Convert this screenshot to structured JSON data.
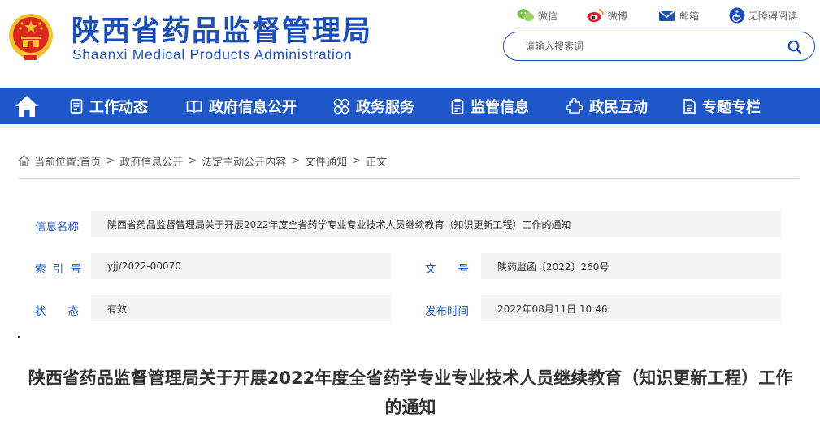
{
  "header": {
    "site_name_cn": "陕西省药品监督管理局",
    "site_name_en": "Shaanxi Medical Products Administration",
    "links": {
      "wechat": "微信",
      "weibo": "微博",
      "mailbox": "邮箱",
      "accessibility": "无障碍阅读"
    },
    "search": {
      "placeholder": "请输入搜索词"
    }
  },
  "nav": {
    "items": [
      {
        "label": "工作动态",
        "icon": "document-list-icon"
      },
      {
        "label": "政府信息公开",
        "icon": "book-icon"
      },
      {
        "label": "政务服务",
        "icon": "grid-icon"
      },
      {
        "label": "监管信息",
        "icon": "clipboard-icon"
      },
      {
        "label": "政民互动",
        "icon": "puzzle-icon"
      },
      {
        "label": "专题专栏",
        "icon": "file-icon"
      }
    ]
  },
  "breadcrumb": {
    "prefix": "当前位置:",
    "items": [
      "首页",
      "政府信息公开",
      "法定主动公开内容",
      "文件通知",
      "正文"
    ]
  },
  "info": {
    "name_label": "信息名称",
    "name_value": "陕西省药品监督管理局关于开展2022年度全省药学专业专业技术人员继续教育（知识更新工程）工作的通知",
    "index_label": "索 引 号",
    "index_value": "yjj/2022-00070",
    "docno_label": "文　　号",
    "docno_value": "陕药监函〔2022〕260号",
    "status_label": "状　　态",
    "status_value": "有效",
    "date_label": "发布时间",
    "date_value": "2022年08月11日 10:46"
  },
  "article": {
    "title": "陕西省药品监督管理局关于开展2022年度全省药学专业专业技术人员继续教育（知识更新工程）工作的通知"
  },
  "colors": {
    "brand_blue": "#1d4fb8",
    "nav_blue": "#1e57c8",
    "emblem_red": "#d9291c",
    "emblem_gold": "#f2c230"
  }
}
